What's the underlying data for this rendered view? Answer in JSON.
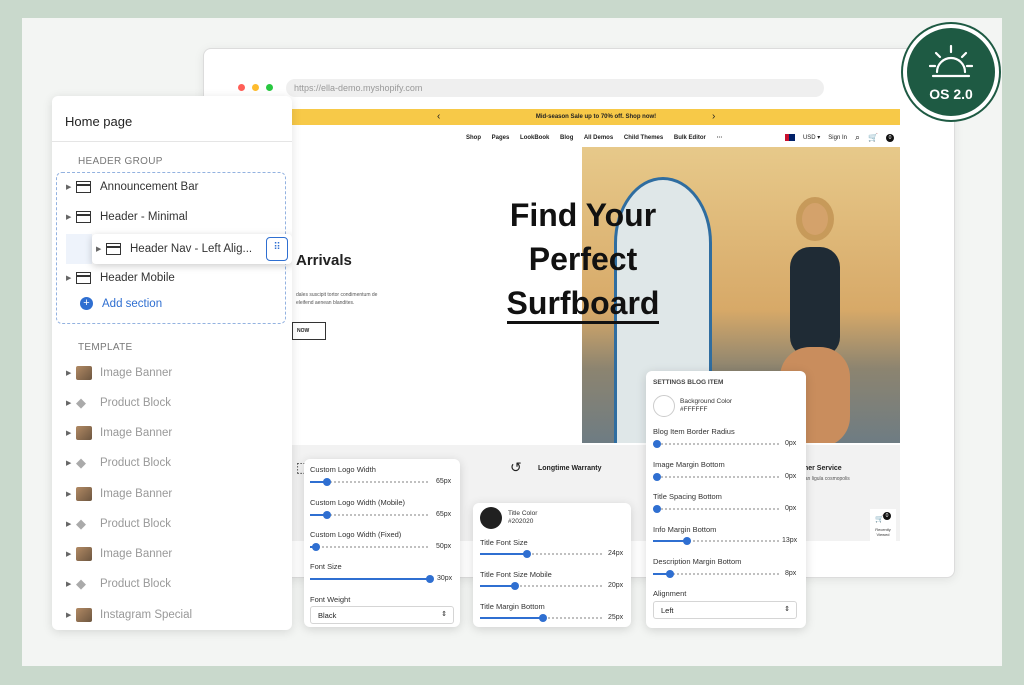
{
  "browser": {
    "url": "https://ella-demo.myshopify.com"
  },
  "site": {
    "promo": "Mid-season Sale up to 70% off. Shop now!",
    "nav": [
      "Shop",
      "Pages",
      "LookBook",
      "Blog",
      "All Demos",
      "Child Themes",
      "Bulk Editor",
      "···"
    ],
    "currency": "USD ▾",
    "signin": "Sign In",
    "cart_count": "0",
    "hero_line1": "Find Your",
    "hero_line2": "Perfect",
    "hero_line3": "Surfboard",
    "arrivals": "Arrivals",
    "arrivals_text": "dales suscipit tortor condimentum de eleifend aenean blandites.",
    "now_btn": "NOW",
    "feature_warranty": "Longtime Warranty",
    "feature_service": "mer Service",
    "feature_service_sub": "ean ligula cosmopolis",
    "recently_count": "0",
    "recently_label": "Recently Viewed"
  },
  "badge": {
    "label": "OS 2.0"
  },
  "panel": {
    "title": "Home page",
    "header_group": "HEADER GROUP",
    "template": "TEMPLATE",
    "header_items": [
      "Announcement Bar",
      "Header - Minimal",
      "Header Mobile"
    ],
    "dragging_item": "Header Nav - Left Alig...",
    "add_section": "Add section",
    "template_items": [
      "Image Banner",
      "Product Block",
      "Image Banner",
      "Product Block",
      "Image Banner",
      "Product Block",
      "Image Banner",
      "Product Block",
      "Instagram Special"
    ]
  },
  "logo_settings": {
    "custom_logo_width": "Custom Logo Width",
    "custom_logo_width_value": "65px",
    "custom_logo_width_mobile": "Custom Logo Width (Mobile)",
    "custom_logo_width_mobile_value": "65px",
    "custom_logo_width_fixed": "Custom Logo Width (Fixed)",
    "custom_logo_width_fixed_value": "50px",
    "font_size": "Font Size",
    "font_size_value": "30px",
    "font_weight": "Font Weight",
    "font_weight_value": "Black"
  },
  "title_settings": {
    "title_color": "Title Color",
    "title_color_value": "#202020",
    "title_font_size": "Title Font Size",
    "title_font_size_value": "24px",
    "title_font_size_mobile": "Title Font Size Mobile",
    "title_font_size_mobile_value": "20px",
    "title_margin_bottom": "Title Margin Bottom",
    "title_margin_bottom_value": "25px"
  },
  "blog_settings": {
    "heading": "SETTINGS BLOG ITEM",
    "background_color": "Background Color",
    "background_color_value": "#FFFFFF",
    "border_radius": "Blog Item Border Radius",
    "border_radius_value": "0px",
    "image_margin_bottom": "Image Margin Bottom",
    "image_margin_bottom_value": "0px",
    "title_spacing_bottom": "Title Spacing Bottom",
    "title_spacing_bottom_value": "0px",
    "info_margin_bottom": "Info Margin Bottom",
    "info_margin_bottom_value": "13px",
    "description_margin_bottom": "Description Margin Bottom",
    "description_margin_bottom_value": "8px",
    "alignment": "Alignment",
    "alignment_value": "Left"
  },
  "colors": {
    "accent": "#2f6fd1",
    "badge": "#1e5a43",
    "promo": "#f7c948",
    "title_swatch": "#202020"
  }
}
